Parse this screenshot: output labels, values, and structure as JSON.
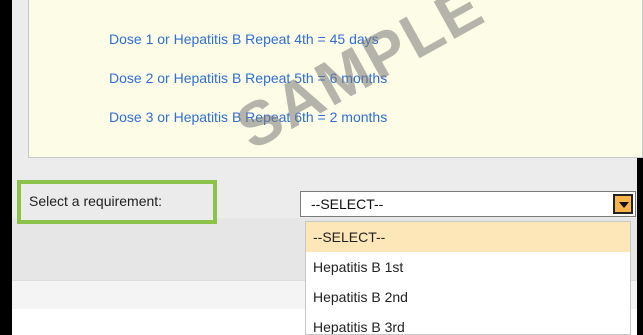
{
  "notes": [
    "Dose 1 or Hepatitis B Repeat 4th = 45 days",
    "Dose 2 or Hepatitis B Repeat 5th = 6 months",
    "Dose 3 or Hepatitis B Repeat 6th = 2 months"
  ],
  "requirement": {
    "label": "Select a requirement:",
    "selected": "--SELECT--",
    "options": [
      "--SELECT--",
      "Hepatitis B 1st",
      "Hepatitis B 2nd",
      "Hepatitis B 3rd"
    ]
  },
  "watermark": "SAMPLE",
  "colors": {
    "note_text": "#2f6fd6",
    "highlight_border": "#8cc24a",
    "selected_option_bg": "#fde6b8",
    "dropdown_arrow_bg": "#f6b44a"
  }
}
